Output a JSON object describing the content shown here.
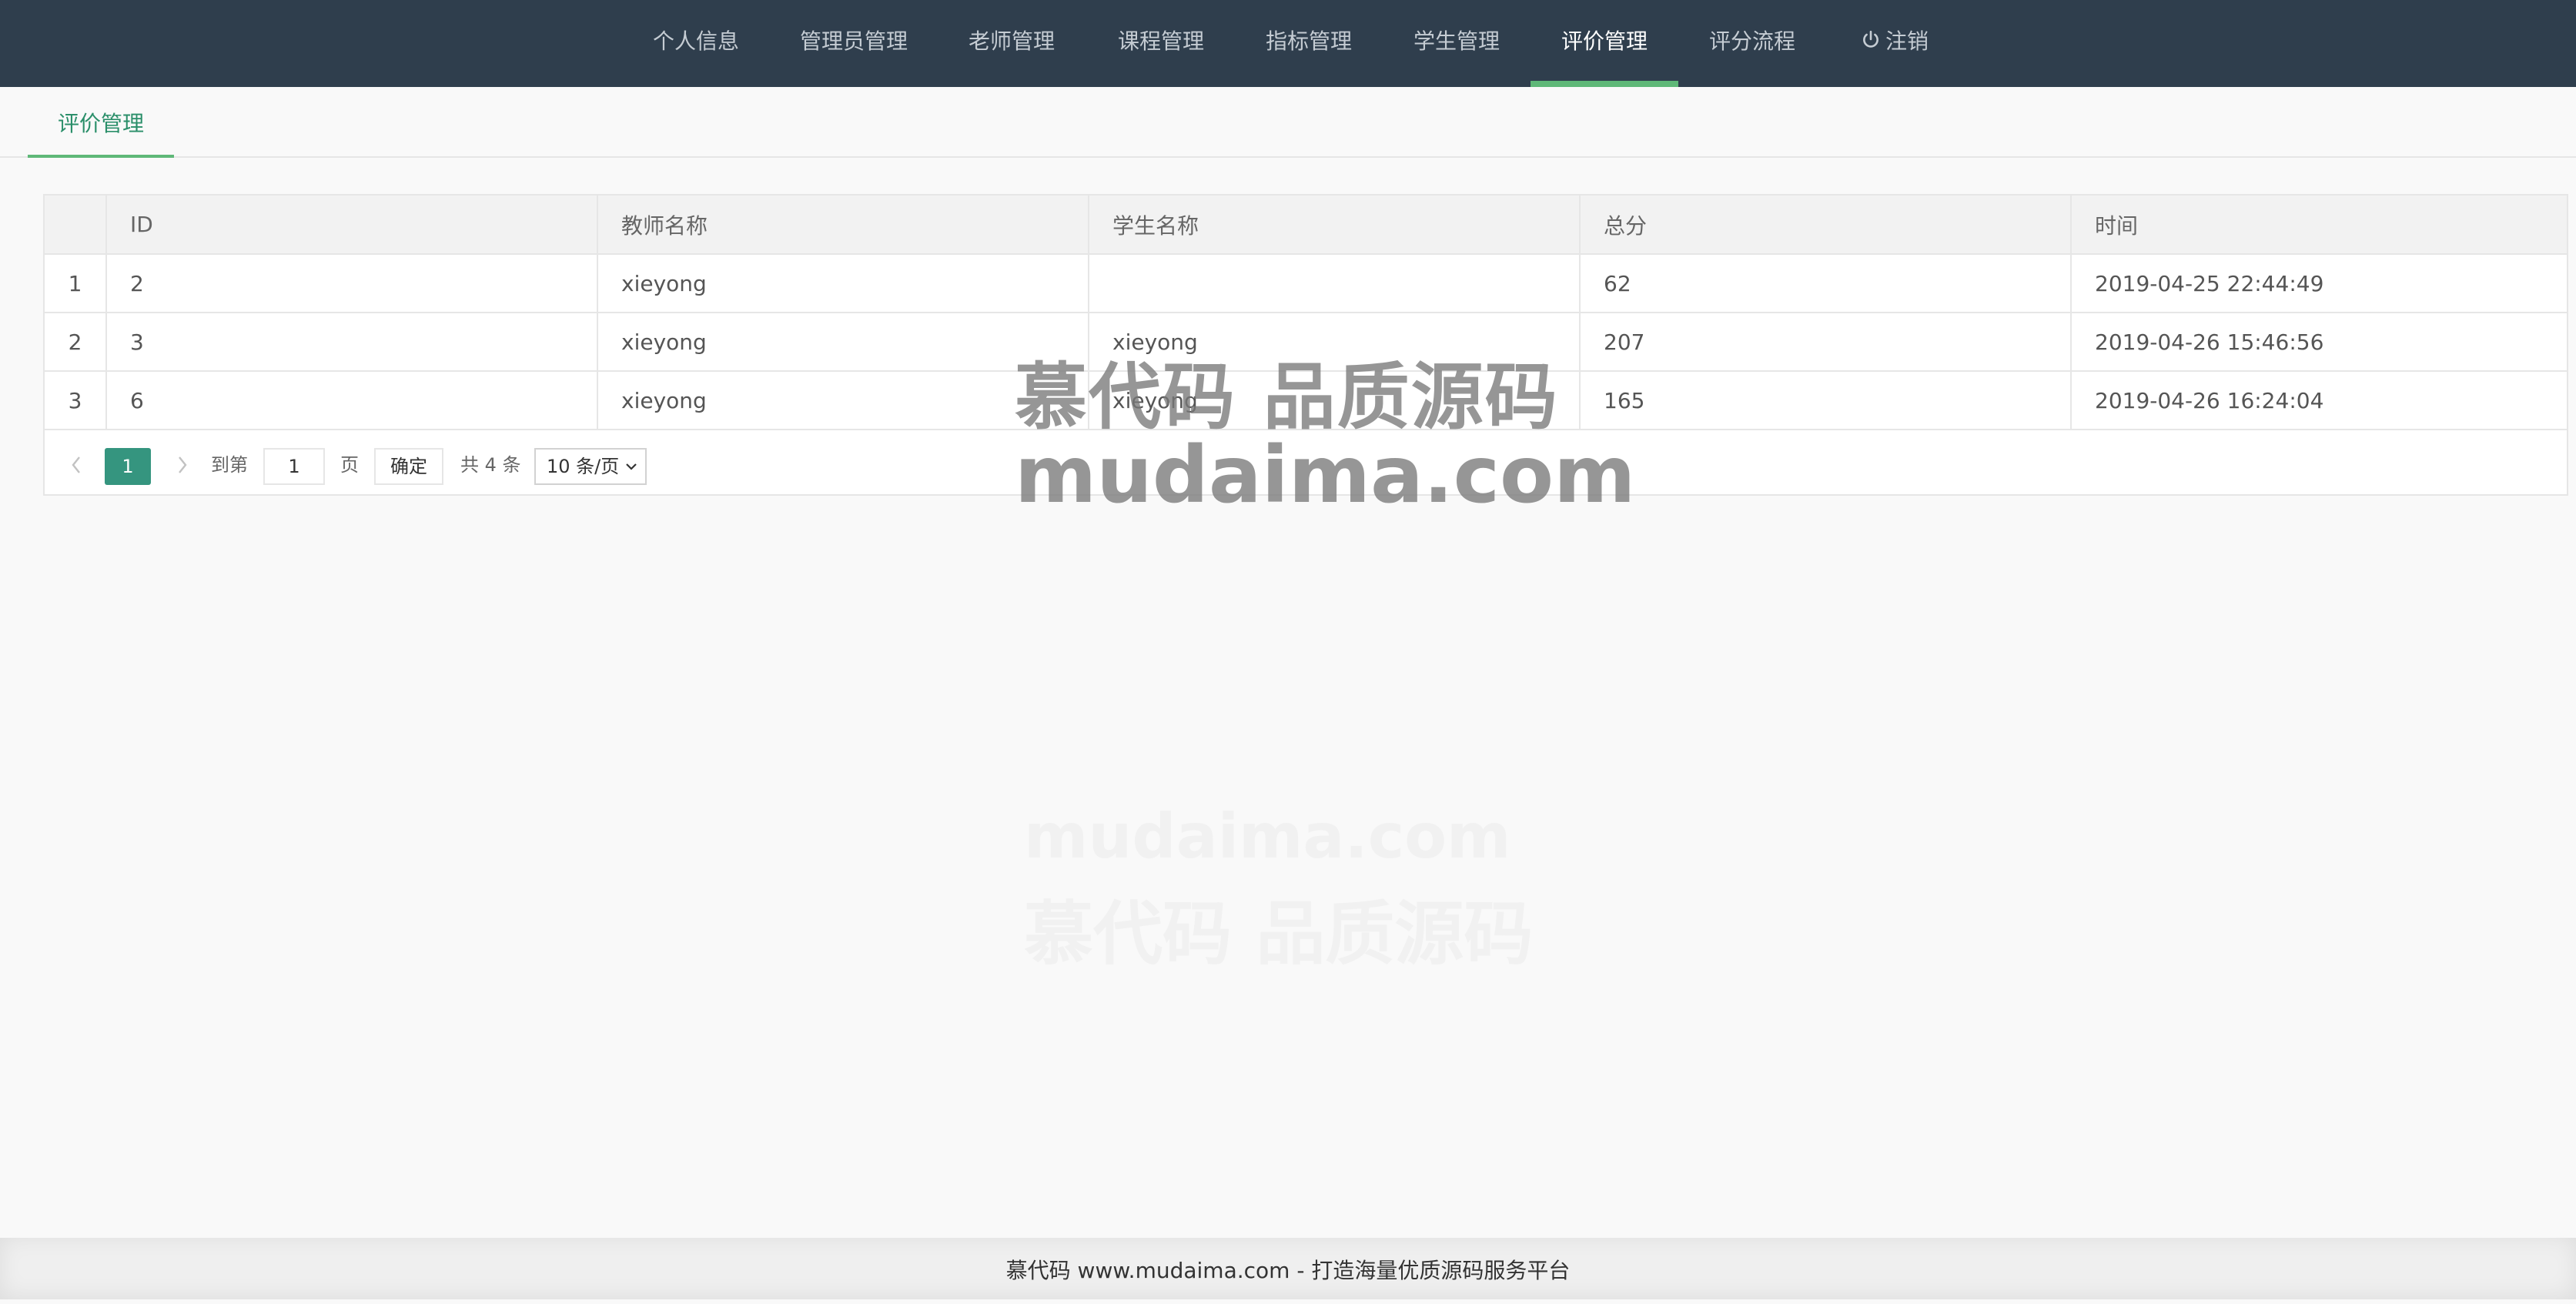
{
  "nav": {
    "items": [
      {
        "label": "个人信息"
      },
      {
        "label": "管理员管理"
      },
      {
        "label": "老师管理"
      },
      {
        "label": "课程管理"
      },
      {
        "label": "指标管理"
      },
      {
        "label": "学生管理"
      },
      {
        "label": "评价管理",
        "active": true
      },
      {
        "label": "评分流程"
      },
      {
        "label": "注销",
        "icon": "power-icon"
      }
    ]
  },
  "tabs": [
    {
      "label": "评价管理",
      "active": true
    }
  ],
  "table": {
    "columns": [
      "",
      "ID",
      "教师名称",
      "学生名称",
      "总分",
      "时间"
    ],
    "rows": [
      {
        "num": "1",
        "id": "2",
        "teacher": "xieyong",
        "student": "",
        "score": "62",
        "time": "2019-04-25 22:44:49"
      },
      {
        "num": "2",
        "id": "3",
        "teacher": "xieyong",
        "student": "xieyong",
        "score": "207",
        "time": "2019-04-26 15:46:56"
      },
      {
        "num": "3",
        "id": "6",
        "teacher": "xieyong",
        "student": "xieyong",
        "score": "165",
        "time": "2019-04-26 16:24:04"
      }
    ]
  },
  "pager": {
    "prev_icon": "chevron-left-icon",
    "next_icon": "chevron-right-icon",
    "current": "1",
    "goto_label": "到第",
    "goto_value": "1",
    "page_label": "页",
    "confirm_label": "确定",
    "total_label": "共 4 条",
    "page_size": "10 条/页"
  },
  "watermark": {
    "line1": "慕代码 品质源码",
    "line2": "mudaima.com"
  },
  "footer": {
    "text": "慕代码 www.mudaima.com - 打造海量优质源码服务平台"
  },
  "colors": {
    "nav_bg": "#2f3e4d",
    "accent": "#5fb878",
    "pager_active": "#35957f"
  }
}
